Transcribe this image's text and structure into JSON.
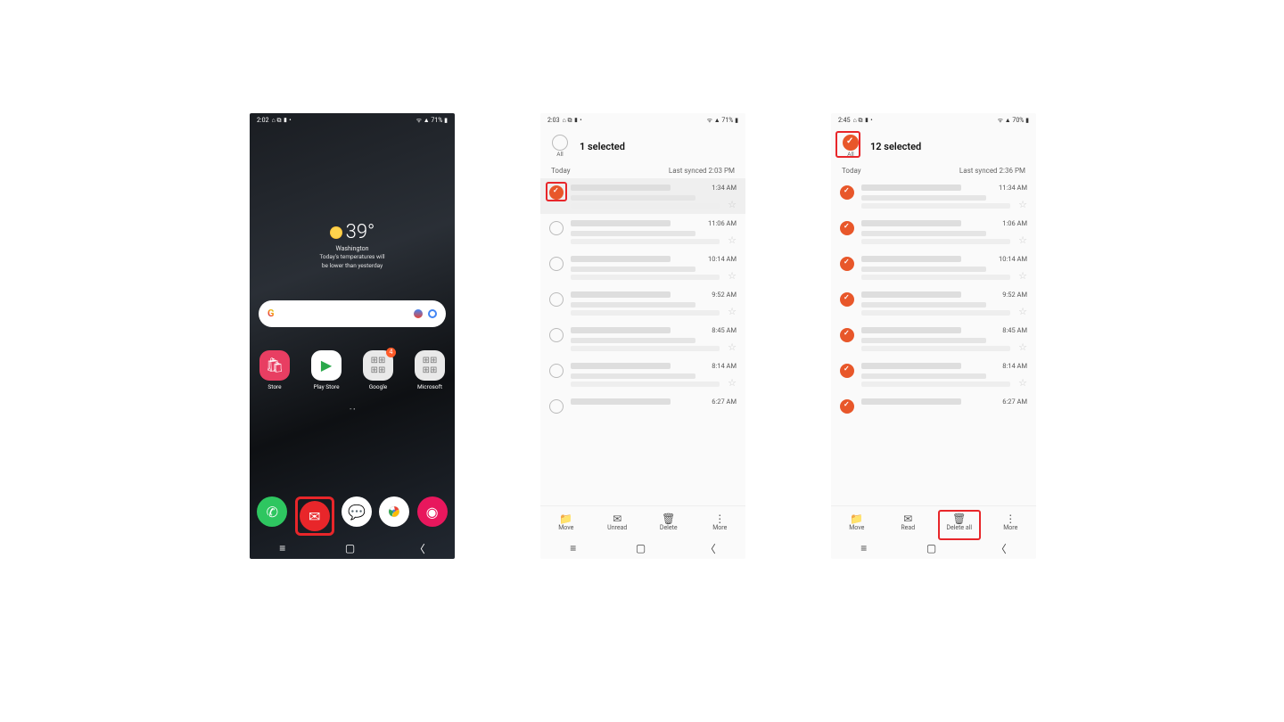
{
  "screen1": {
    "status": {
      "time": "2:02",
      "icons": "⌂ ⧉ ▮ •",
      "right": "ᯤ ▲ 71% ▮"
    },
    "weather": {
      "temp": "39°",
      "city": "Washington",
      "line1": "Today's temperatures will",
      "line2": "be lower than yesterday"
    },
    "apps": [
      {
        "label": "Store",
        "color": "#e83e62",
        "glyph": "🛍"
      },
      {
        "label": "Play Store",
        "color": "#ffffff",
        "glyph": "▶"
      },
      {
        "label": "Google",
        "color": "#e9e9e9",
        "glyph": "⊞",
        "badge": "4"
      },
      {
        "label": "Microsoft",
        "color": "#e9e9e9",
        "glyph": "⊞"
      }
    ],
    "dock": {
      "phone": {
        "color": "#2ec660",
        "glyph": "📞"
      },
      "email": {
        "color": "#e8262a",
        "glyph": "✉"
      },
      "messages": {
        "color": "#ffffff",
        "glyph": "💬"
      },
      "chrome": {
        "color": "#ffffff",
        "glyph": "◎"
      },
      "camera": {
        "color": "#e8175d",
        "glyph": "◉"
      }
    }
  },
  "screen2": {
    "status": {
      "time": "2:03",
      "icons": "⌂ ⧉ ▮ •",
      "right": "ᯤ ▲ 71% ▮"
    },
    "selected": "1 selected",
    "all": "All",
    "today": "Today",
    "sync": "Last synced  2:03 PM",
    "times": [
      "1:34 AM",
      "11:06 AM",
      "10:14 AM",
      "9:52 AM",
      "8:45 AM",
      "8:14 AM",
      "6:27 AM"
    ],
    "bbar": [
      "Move",
      "Unread",
      "Delete",
      "More"
    ]
  },
  "screen3": {
    "status": {
      "time": "2:45",
      "icons": "⌂ ⧉ ▮ •",
      "right": "ᯤ ▲ 70% ▮"
    },
    "selected": "12 selected",
    "all": "All",
    "today": "Today",
    "sync": "Last synced  2:36 PM",
    "times": [
      "11:34 AM",
      "1:06 AM",
      "10:14 AM",
      "9:52 AM",
      "8:45 AM",
      "8:14 AM",
      "6:27 AM"
    ],
    "bbar": [
      "Move",
      "Read",
      "Delete all",
      "More"
    ]
  }
}
